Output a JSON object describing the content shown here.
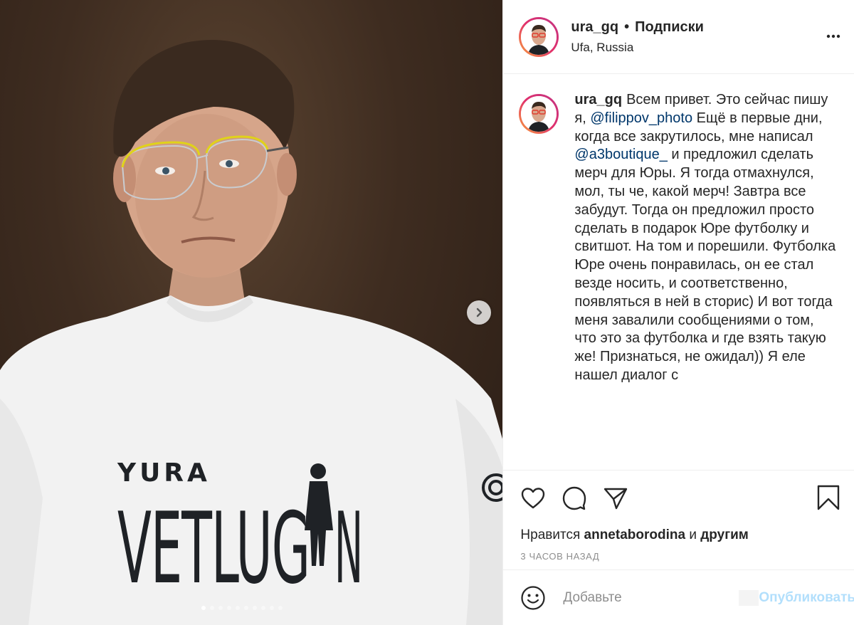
{
  "header": {
    "username": "ura_gq",
    "bullet": "•",
    "follow_label": "Подписки",
    "location": "Ufa, Russia"
  },
  "caption": {
    "username": "ura_gq",
    "segments": [
      {
        "type": "text",
        "value": "Всем привет. Это сейчас пишу я, "
      },
      {
        "type": "mention",
        "value": "@filippov_photo"
      },
      {
        "type": "text",
        "value": " Ещё в первые дни, когда все закрутилось, мне написал "
      },
      {
        "type": "mention",
        "value": "@a3boutique_"
      },
      {
        "type": "text",
        "value": " и предложил сделать мерч для Юры. Я тогда отмахнулся, мол, ты че, какой мерч! Завтра все забудут. Тогда он предложил просто сделать в подарок Юре футболку и свитшот. На том и порешили. Футболка Юре очень понравилась, он ее стал везде носить, и соответственно, появляться в ней в сторис) И вот тогда меня завалили сообщениями о том, что это за футболка и где взять такую же! Признаться, не ожидал)) Я еле нашел диалог с"
      }
    ]
  },
  "photo": {
    "shirt_line1": "YURA",
    "shirt_line2": "VETLUG",
    "shirt_line3": "N",
    "slide_count": 10,
    "active_slide": 1
  },
  "likes": {
    "prefix": "Нравится",
    "user": "annetaborodina",
    "conj": "и",
    "others": "другим"
  },
  "timestamp": "3 ЧАСОВ НАЗАД",
  "comment": {
    "placeholder": "Добавьте",
    "publish_label": "Опубликовать"
  },
  "icons": {
    "more": "more-horizontal-icon",
    "like": "heart-icon",
    "comment": "comment-bubble-icon",
    "share": "paper-plane-icon",
    "save": "bookmark-icon",
    "emoji": "smiley-icon",
    "next": "chevron-right-icon"
  },
  "colors": {
    "mention": "#00376b",
    "publish_disabled": "#b2dffc",
    "muted": "#8e8e8e",
    "avatar_ring_start": "#f9a33a",
    "avatar_ring_end": "#c13584"
  }
}
